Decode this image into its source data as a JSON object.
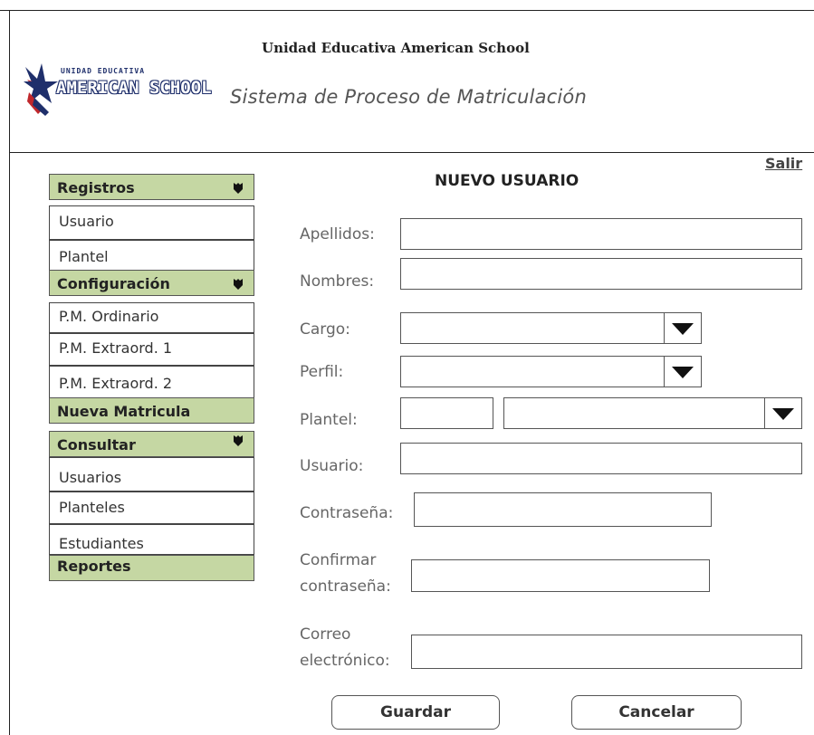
{
  "header": {
    "school_name": "Unidad Educativa American School",
    "system_title": "Sistema de Proceso de Matriculación",
    "logo_small_text": "UNIDAD EDUCATIVA",
    "logo_big_text": "AMERICAN SCHOOL"
  },
  "logout_label": "Salir",
  "sidebar": {
    "registros": {
      "label": "Registros",
      "items": [
        "Usuario",
        "Plantel"
      ]
    },
    "configuracion": {
      "label": "Configuración",
      "items": [
        "P.M. Ordinario",
        "P.M. Extraord. 1",
        "P.M. Extraord. 2"
      ]
    },
    "nueva_matricula": {
      "label": "Nueva Matricula"
    },
    "consultar": {
      "label": "Consultar",
      "items": [
        "Usuarios",
        "Planteles",
        "Estudiantes"
      ]
    },
    "reportes": {
      "label": "Reportes"
    }
  },
  "form": {
    "title": "NUEVO USUARIO",
    "apellidos_label": "Apellidos:",
    "nombres_label": "Nombres:",
    "cargo_label": "Cargo:",
    "perfil_label": "Perfil:",
    "plantel_label": "Plantel:",
    "usuario_label": "Usuario:",
    "contrasena_label": "Contraseña:",
    "confirmar_label_1": "Confirmar",
    "confirmar_label_2": "contraseña:",
    "correo_label_1": "Correo",
    "correo_label_2": "electrónico:",
    "save_label": "Guardar",
    "cancel_label": "Cancelar"
  },
  "colors": {
    "menu_category_bg": "#c5d7a3",
    "logo_blue": "#1f2f6b",
    "logo_red": "#c0282d"
  },
  "icons": {
    "menu_caret": "caret-down-icon",
    "select_arrow": "triangle-down-icon"
  }
}
